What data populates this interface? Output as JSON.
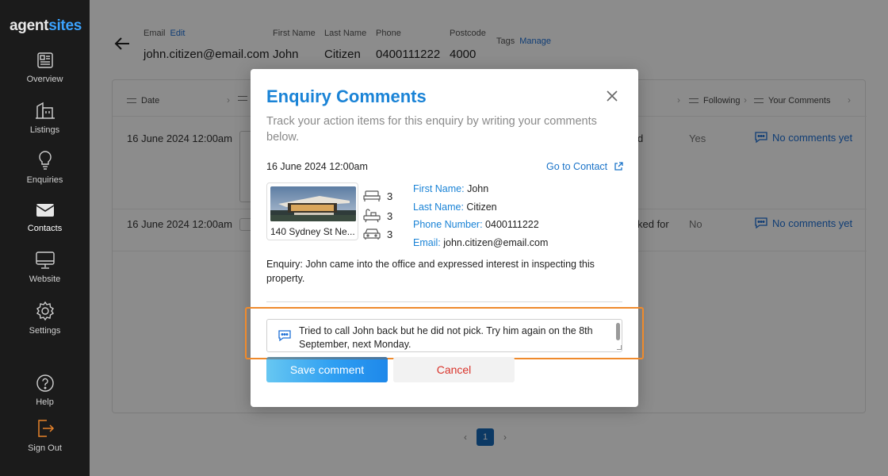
{
  "sidebar": {
    "logo_part1": "agent",
    "logo_part2": "sites",
    "items": [
      {
        "label": "Overview",
        "icon": "newspaper-icon"
      },
      {
        "label": "Listings",
        "icon": "building-icon"
      },
      {
        "label": "Enquiries",
        "icon": "lightbulb-icon"
      },
      {
        "label": "Contacts",
        "icon": "envelope-icon"
      },
      {
        "label": "Website",
        "icon": "monitor-icon"
      },
      {
        "label": "Settings",
        "icon": "gear-icon"
      },
      {
        "label": "Help",
        "icon": "question-icon"
      },
      {
        "label": "Sign Out",
        "icon": "sign-out-icon"
      }
    ]
  },
  "contact_header": {
    "email_label": "Email",
    "email_edit": "Edit",
    "email_value": "john.citizen@email.com",
    "first_name_label": "First Name",
    "first_name_value": "John",
    "last_name_label": "Last Name",
    "last_name_value": "Citizen",
    "phone_label": "Phone",
    "phone_value": "0400111222",
    "postcode_label": "Postcode",
    "postcode_value": "4000",
    "tags_label": "Tags",
    "tags_manage": "Manage"
  },
  "table": {
    "headers": {
      "date": "Date",
      "following": "Following",
      "your_comments": "Your Comments"
    },
    "rows": [
      {
        "date": "16 June 2024 12:00am",
        "status_fragment": "d",
        "following": "Yes",
        "comments": "No comments yet"
      },
      {
        "date": "16 June 2024 12:00am",
        "status_fragment": "ked for",
        "following": "No",
        "comments": "No comments yet"
      }
    ]
  },
  "pagination": {
    "current_page": "1",
    "prev": "‹",
    "next": "›"
  },
  "modal": {
    "title": "Enquiry Comments",
    "subtitle": "Track your action items for this enquiry by writing your comments below.",
    "date": "16 June 2024 12:00am",
    "goto_contact": "Go to Contact",
    "listing": {
      "address": "140 Sydney St Ne...",
      "bedrooms": "3",
      "bathrooms": "3",
      "car_spaces": "3"
    },
    "contact": {
      "first_name_label": "First Name:",
      "first_name": "John",
      "last_name_label": "Last Name:",
      "last_name": "Citizen",
      "phone_label": "Phone Number:",
      "phone": "0400111222",
      "email_label": "Email:",
      "email": "john.citizen@email.com"
    },
    "enquiry_text": "Enquiry: John came into the office and expressed interest in inspecting this property.",
    "comment_value": "Tried to call John back but he did not pick. Try him again on the 8th September, next Monday.",
    "save_label": "Save comment",
    "cancel_label": "Cancel"
  },
  "colors": {
    "accent": "#1a83d6",
    "highlight": "#ef8a2c",
    "cancel": "#d9342b",
    "sidebar_bg": "#1b1b1b"
  }
}
